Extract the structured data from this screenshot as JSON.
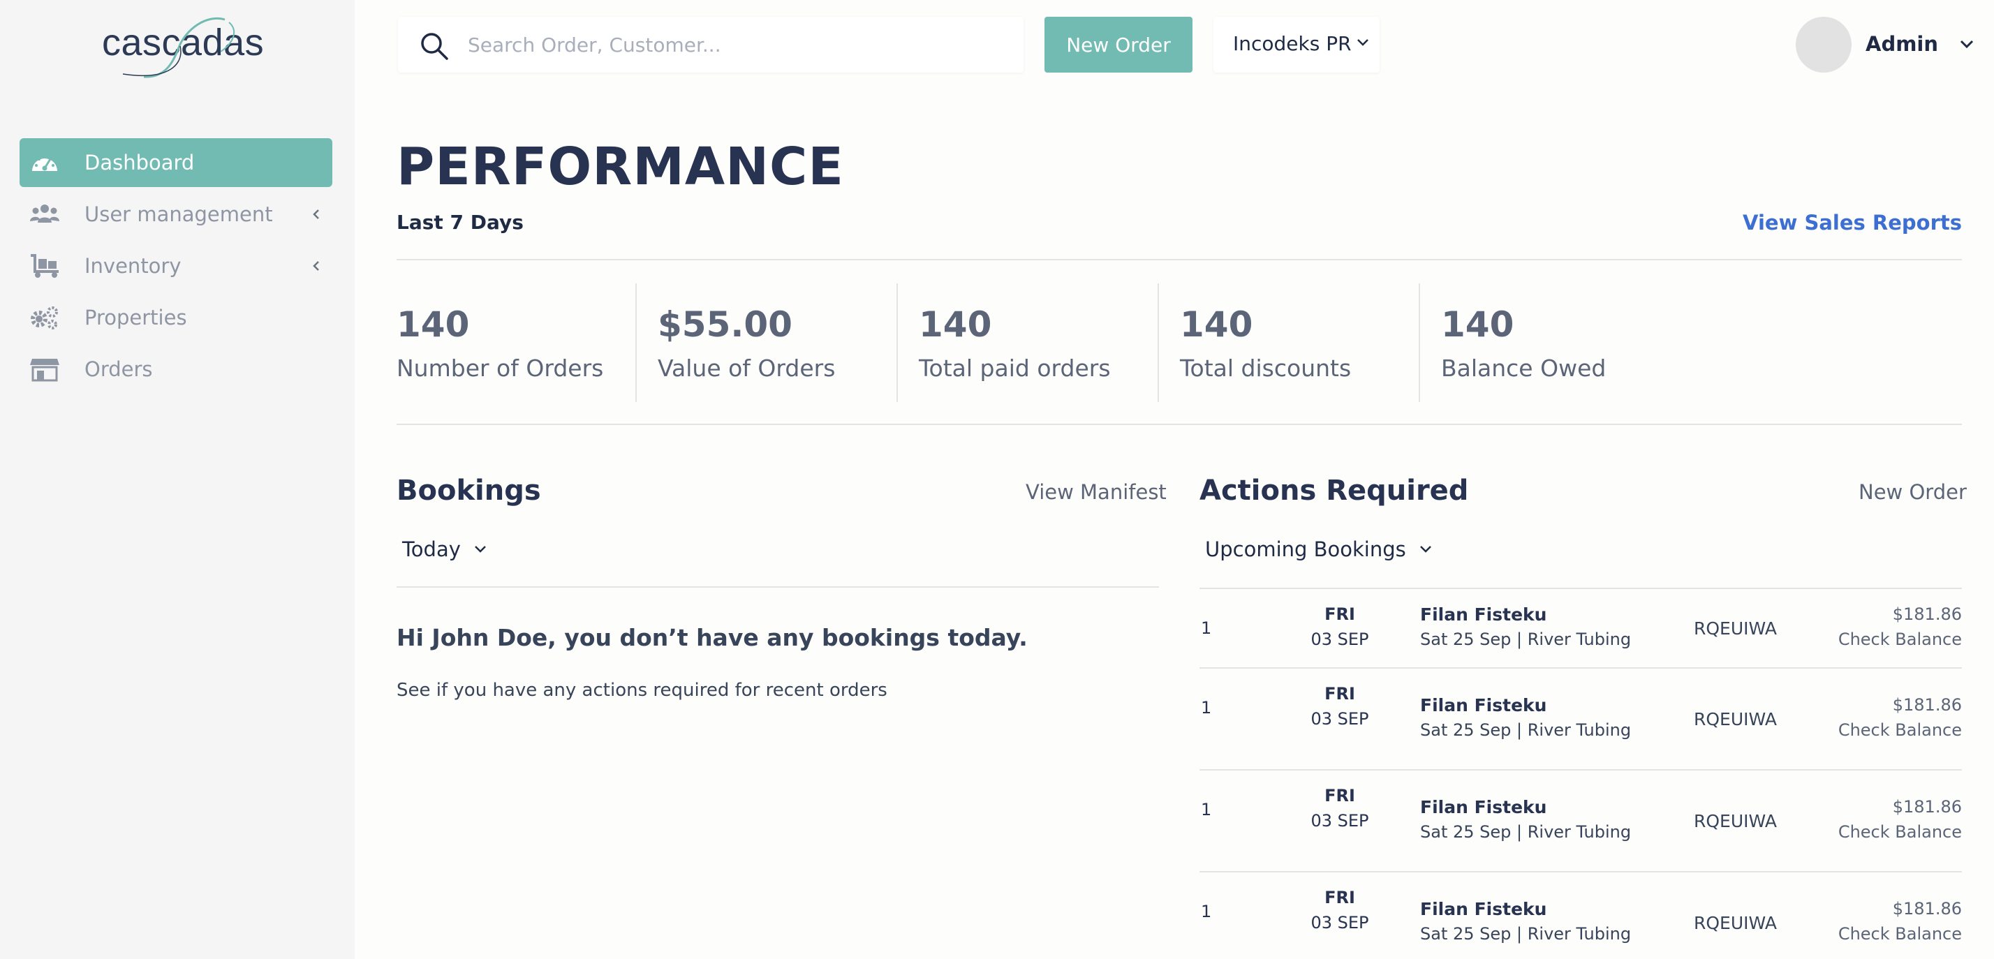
{
  "app": {
    "logo_text": "cascadas"
  },
  "sidebar": {
    "items": [
      {
        "label": "Dashboard",
        "icon": "dashboard-gauge-icon",
        "active": true
      },
      {
        "label": "User management",
        "icon": "users-icon",
        "has_submenu": true
      },
      {
        "label": "Inventory",
        "icon": "dolly-cart-icon",
        "has_submenu": true
      },
      {
        "label": "Properties",
        "icon": "gears-icon"
      },
      {
        "label": "Orders",
        "icon": "store-icon"
      }
    ]
  },
  "topbar": {
    "search_placeholder": "Search Order, Customer...",
    "search_value": "",
    "new_order_label": "New Order",
    "company_selected": "Incodeks PR",
    "user_name": "Admin"
  },
  "performance": {
    "title": "PERFORMANCE",
    "period": "Last 7 Days",
    "view_sales_label": "View Sales Reports",
    "stats": [
      {
        "value": "140",
        "label": "Number of Orders"
      },
      {
        "value": "$55.00",
        "label": "Value of Orders"
      },
      {
        "value": "140",
        "label": "Total paid orders"
      },
      {
        "value": "140",
        "label": "Total discounts"
      },
      {
        "value": "140",
        "label": "Balance Owed"
      }
    ]
  },
  "bookings": {
    "title": "Bookings",
    "link_label": "View Manifest",
    "filter_selected": "Today",
    "empty_message": "Hi John Doe, you don’t have any bookings today.",
    "empty_sub": "See if you have any actions required for recent orders"
  },
  "actions": {
    "title": "Actions Required",
    "link_label": "New Order",
    "filter_selected": "Upcoming Bookings",
    "rows": [
      {
        "index": "1",
        "day": "FRI",
        "date": "03 SEP",
        "name": "Filan Fisteku",
        "detail": "Sat 25 Sep | River Tubing",
        "code": "RQEUIWA",
        "amount": "$181.86",
        "action": "Check Balance"
      },
      {
        "index": "1",
        "day": "FRI",
        "date": "03 SEP",
        "name": "Filan Fisteku",
        "detail": "Sat 25 Sep | River Tubing",
        "code": "RQEUIWA",
        "amount": "$181.86",
        "action": "Check Balance"
      },
      {
        "index": "1",
        "day": "FRI",
        "date": "03 SEP",
        "name": "Filan Fisteku",
        "detail": "Sat 25 Sep | River Tubing",
        "code": "RQEUIWA",
        "amount": "$181.86",
        "action": "Check Balance"
      },
      {
        "index": "1",
        "day": "FRI",
        "date": "03 SEP",
        "name": "Filan Fisteku",
        "detail": "Sat 25 Sep | River Tubing",
        "code": "RQEUIWA",
        "amount": "$181.86",
        "action": "Check Balance"
      }
    ]
  },
  "colors": {
    "accent": "#71bbb3",
    "link_blue": "#3d6fd3",
    "heading": "#273351",
    "muted": "#5b6577",
    "sidebar_bg": "#f5f5f6"
  }
}
